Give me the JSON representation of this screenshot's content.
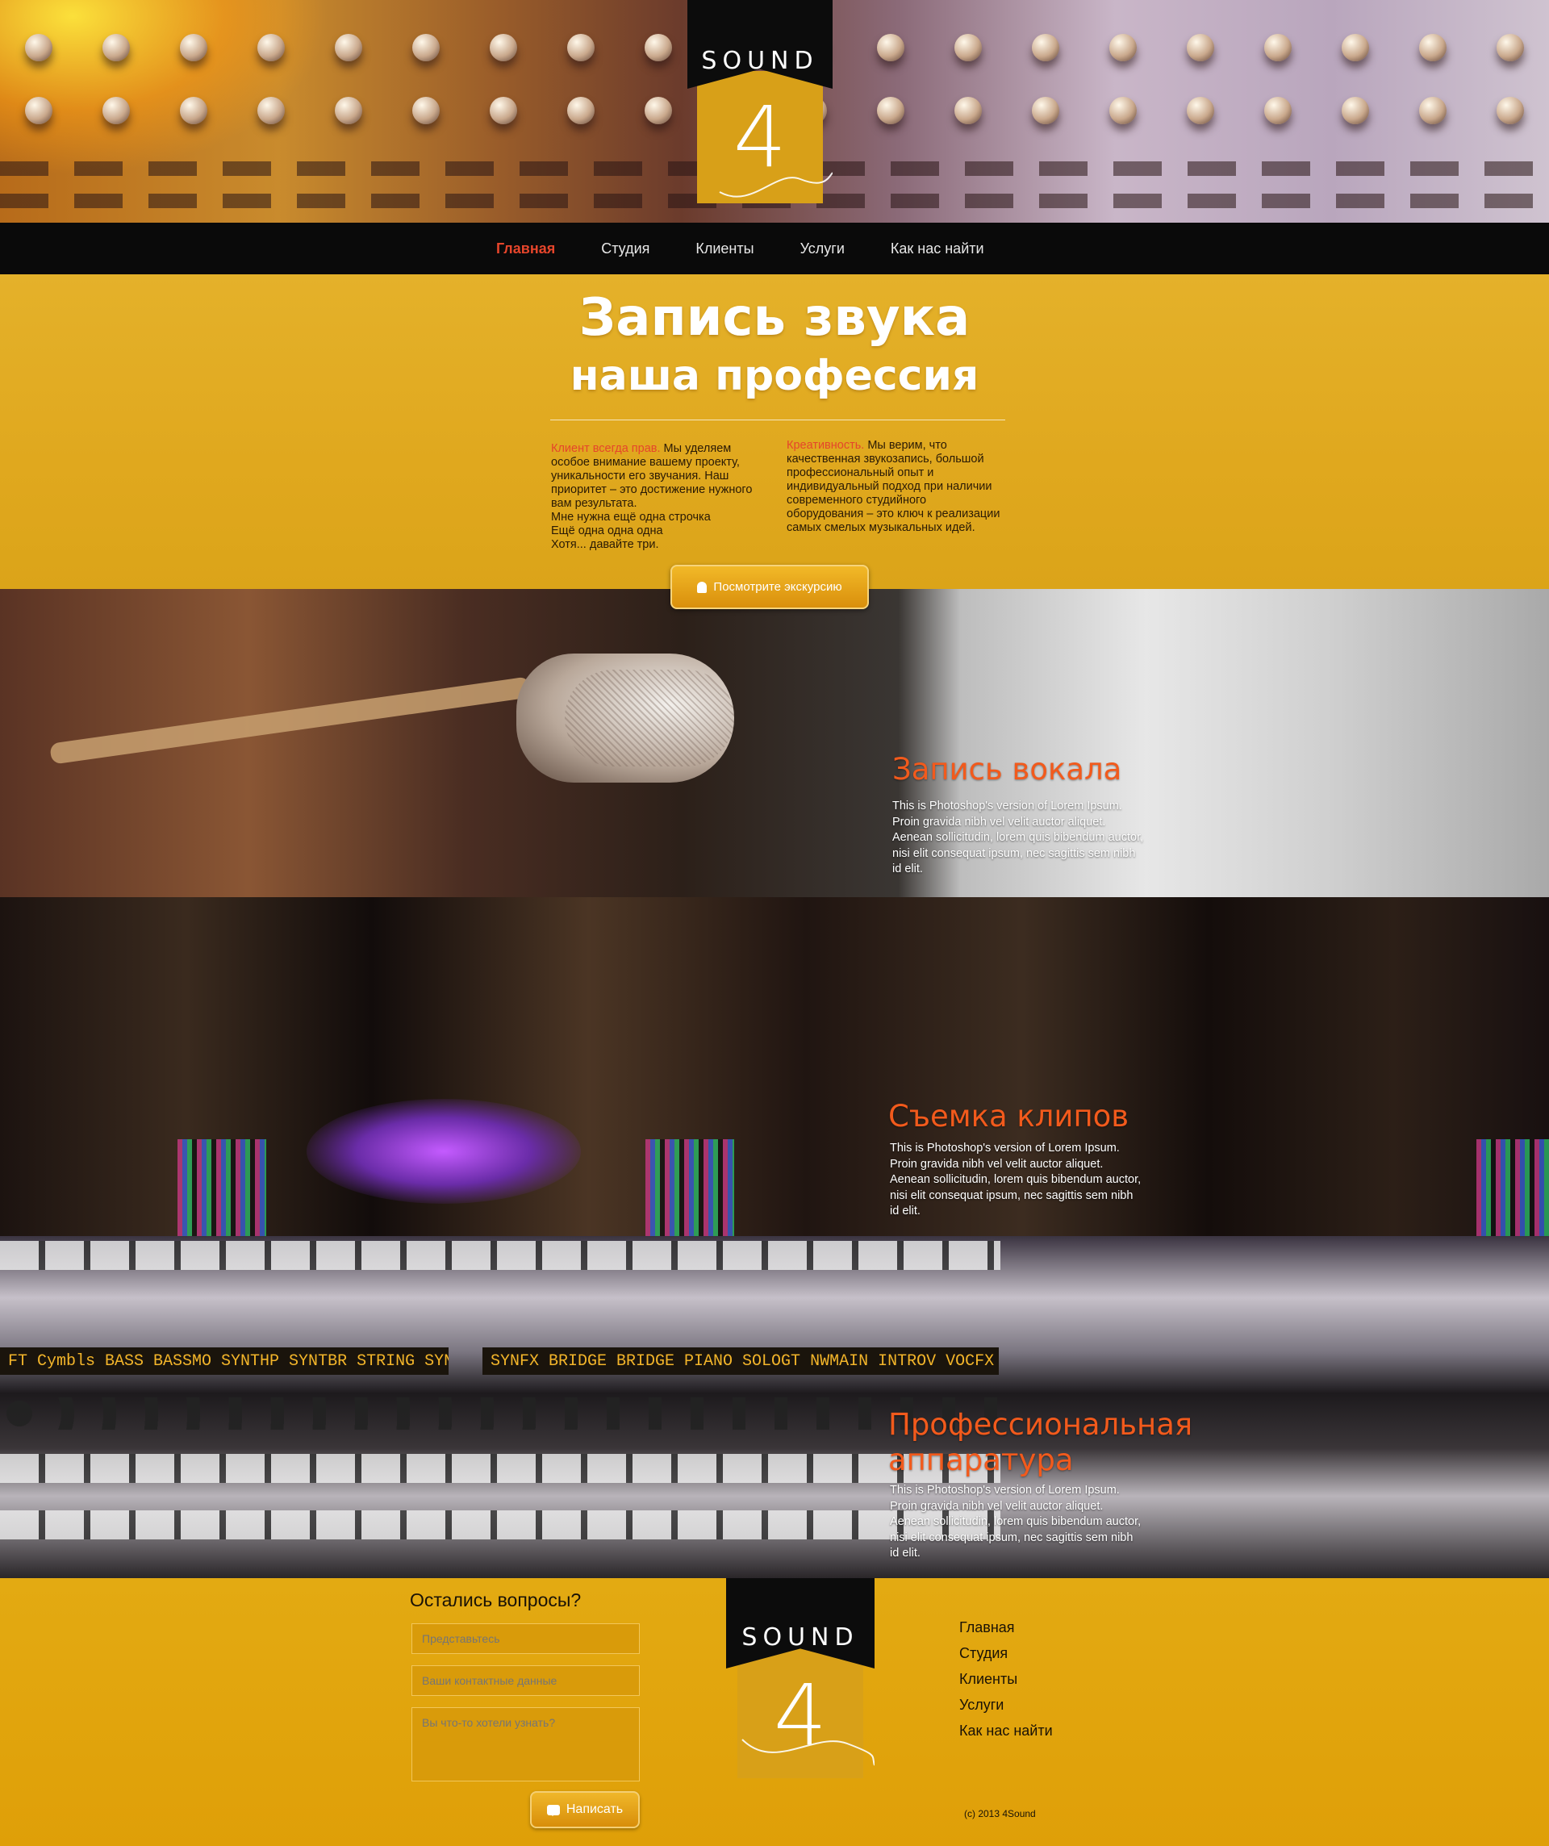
{
  "logo": {
    "word": "SOUND",
    "number": "4"
  },
  "nav": {
    "items": [
      {
        "label": "Главная",
        "active": true
      },
      {
        "label": "Студия"
      },
      {
        "label": "Клиенты"
      },
      {
        "label": "Услуги"
      },
      {
        "label": "Как нас найти"
      }
    ]
  },
  "hero": {
    "title": "Запись звука",
    "subtitle": "наша профессия",
    "col1": {
      "lead": "Клиент всегда прав.",
      "text": " Мы уделяем особое внимание вашему проекту, уникальности его звучания. Наш приоритет – это достижение нужного вам результата.",
      "extra": [
        "Мне нужна ещё одна строчка",
        "Ещё одна одна одна",
        "Хотя... давайте три."
      ]
    },
    "col2": {
      "lead": "Креативность.",
      "text": " Мы верим, что качественная звукозапись, большой профессиональный опыт и индивидуальный подход при наличии современного студийного оборудования – это ключ к реализации самых смелых музыкальных идей."
    },
    "tour_button": "Посмотрите экскурсию"
  },
  "features": [
    {
      "title": "Запись вокала",
      "text": "This is Photoshop's version  of Lorem Ipsum. Proin gravida nibh vel velit auctor aliquet. Aenean sollicitudin, lorem quis bibendum auctor, nisi elit consequat ipsum, nec sagittis sem nibh id elit."
    },
    {
      "title": "Съемка клипов",
      "text": "This is Photoshop's version  of Lorem Ipsum. Proin gravida nibh vel velit auctor aliquet. Aenean sollicitudin, lorem quis bibendum auctor, nisi elit consequat ipsum, nec sagittis sem nibh id elit."
    },
    {
      "title_line1": "Профессиональная",
      "title_line2": "аппаратура",
      "text": "This is Photoshop's version  of Lorem Ipsum. Proin gravida nibh vel velit auctor aliquet. Aenean sollicitudin, lorem quis bibendum auctor, nisi elit consequat ipsum, nec sagittis sem nibh id elit."
    }
  ],
  "console": {
    "lcd_left": "FT Cymbls BASS  BASSMO SYNTHP SYNTBR STRING SYNTHF",
    "lcd_right": "SYNFX  BRIDGE BRIDGE PIANO  SOLOGT NWMAIN INTROV VOCFX"
  },
  "footer": {
    "contact_title": "Остались вопросы?",
    "name_placeholder": "Представьтесь",
    "contact_placeholder": "Ваши контактные данные",
    "message_placeholder": "Вы что-то хотели узнать?",
    "send_button": "Написать",
    "links": [
      "Главная",
      "Студия",
      "Клиенты",
      "Услуги",
      "Как нас найти"
    ],
    "copyright": "(c) 2013 4Sound"
  },
  "colors": {
    "accent": "#f25a1c",
    "nav_active": "#e5452b",
    "gold": "#e0a70d"
  }
}
